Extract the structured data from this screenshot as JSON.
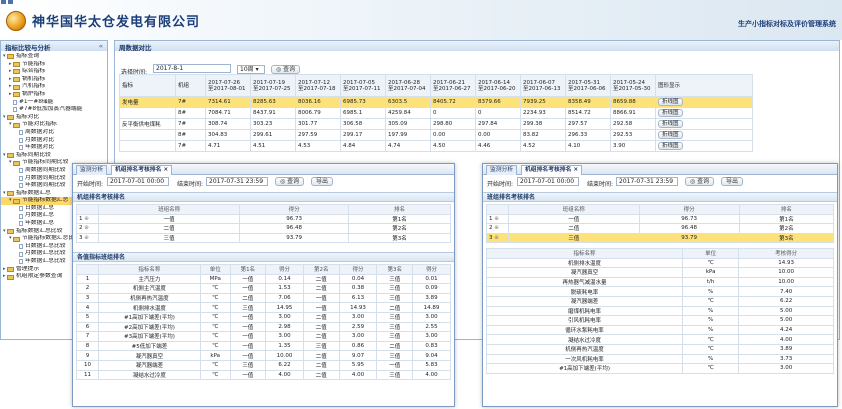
{
  "header": {
    "company": "神华国华太仓发电有限公司",
    "system": "生产小指标对标及评价管理系统"
  },
  "left": {
    "title": "指标比较与分析",
    "collapse": "«",
    "tree": [
      {
        "t": "指标查询",
        "lv": 0,
        "ty": "f",
        "tw": "▾"
      },
      {
        "t": "节能指标",
        "lv": 1,
        "ty": "f",
        "tw": "▸"
      },
      {
        "t": "综合指标",
        "lv": 1,
        "ty": "f",
        "tw": "▸"
      },
      {
        "t": "锅机指标",
        "lv": 1,
        "ty": "f",
        "tw": "▸"
      },
      {
        "t": "汽机指标",
        "lv": 1,
        "ty": "f",
        "tw": "▸"
      },
      {
        "t": "锅炉指标",
        "lv": 1,
        "ty": "f",
        "tw": "▸"
      },
      {
        "t": "#1一#8储能",
        "lv": 1,
        "ty": "d",
        "tw": ""
      },
      {
        "t": "#7#8低加加蒸汽器端能",
        "lv": 1,
        "ty": "d",
        "tw": ""
      },
      {
        "t": "指标对比",
        "lv": 0,
        "ty": "f",
        "tw": "▾"
      },
      {
        "t": "节能对比指标",
        "lv": 1,
        "ty": "f",
        "tw": "▾"
      },
      {
        "t": "周数据对比",
        "lv": 2,
        "ty": "d",
        "tw": ""
      },
      {
        "t": "月数据对比",
        "lv": 2,
        "ty": "d",
        "tw": ""
      },
      {
        "t": "年数据对比",
        "lv": 2,
        "ty": "d",
        "tw": ""
      },
      {
        "t": "指标同期比较",
        "lv": 0,
        "ty": "f",
        "tw": "▾"
      },
      {
        "t": "节能指标同期比较",
        "lv": 1,
        "ty": "f",
        "tw": "▾"
      },
      {
        "t": "周数据同期比较",
        "lv": 2,
        "ty": "d",
        "tw": ""
      },
      {
        "t": "月数据同期比较",
        "lv": 2,
        "ty": "d",
        "tw": ""
      },
      {
        "t": "年数据同期比较",
        "lv": 2,
        "ty": "d",
        "tw": ""
      },
      {
        "t": "指标数据汇总",
        "lv": 0,
        "ty": "f",
        "tw": "▾"
      },
      {
        "t": "节能指标数据汇总",
        "lv": 1,
        "ty": "f",
        "tw": "▾",
        "sel": true
      },
      {
        "t": "日数据汇总",
        "lv": 2,
        "ty": "d",
        "tw": ""
      },
      {
        "t": "月数据汇总",
        "lv": 2,
        "ty": "d",
        "tw": ""
      },
      {
        "t": "年数据汇总",
        "lv": 2,
        "ty": "d",
        "tw": ""
      },
      {
        "t": "指标数据汇总比较",
        "lv": 0,
        "ty": "f",
        "tw": "▾"
      },
      {
        "t": "节能指标数据汇总比较",
        "lv": 1,
        "ty": "f",
        "tw": "▾"
      },
      {
        "t": "日数据汇总比较",
        "lv": 2,
        "ty": "d",
        "tw": ""
      },
      {
        "t": "月数据汇总比较",
        "lv": 2,
        "ty": "d",
        "tw": ""
      },
      {
        "t": "年数据汇总比较",
        "lv": 2,
        "ty": "d",
        "tw": ""
      },
      {
        "t": "管理提示",
        "lv": 0,
        "ty": "f",
        "tw": "▸"
      },
      {
        "t": "机组限定参数查询",
        "lv": 0,
        "ty": "f",
        "tw": "▸"
      }
    ]
  },
  "weekly": {
    "title": "周数据对比",
    "time_label": "选择时间:",
    "time_value": "2017-8-1",
    "weeks_value": "10周",
    "query": "查询",
    "periods": [
      "2017-07-26\n至2017-08-01",
      "2017-07-19\n至2017-07-25",
      "2017-07-12\n至2017-07-18",
      "2017-07-05\n至2017-07-11",
      "2017-06-28\n至2017-07-04",
      "2017-06-21\n至2017-06-27",
      "2017-06-14\n至2017-06-20",
      "2017-06-07\n至2017-06-13",
      "2017-05-31\n至2017-06-06",
      "2017-05-24\n至2017-05-30"
    ],
    "col_ind": "指标",
    "col_unit": "机组",
    "col_chart": "图形显示",
    "chart_btn": "折线图",
    "rows": [
      {
        "ind": "发电量",
        "u": "7#",
        "v": [
          "7314.61",
          "8285.63",
          "8036.16",
          "6985.73",
          "6303.5",
          "8405.72",
          "8379.66",
          "7939.25",
          "8358.49",
          "8659.88"
        ],
        "hl": true
      },
      {
        "ind": "",
        "u": "8#",
        "v": [
          "7084.71",
          "8437.91",
          "8006.79",
          "6985.1",
          "4259.84",
          "0",
          "0",
          "2234.93",
          "8514.72",
          "8866.91"
        ]
      },
      {
        "ind": "反平衡供电煤耗",
        "u": "7#",
        "v": [
          "308.74",
          "303.23",
          "301.77",
          "306.58",
          "305.09",
          "298.80",
          "297.84",
          "299.38",
          "297.57",
          "292.58"
        ]
      },
      {
        "ind": "",
        "u": "8#",
        "v": [
          "304.83",
          "299.61",
          "297.59",
          "299.17",
          "197.99",
          "0.00",
          "0.00",
          "83.82",
          "296.33",
          "292.53"
        ]
      },
      {
        "ind": "",
        "u": "7#",
        "v": [
          "4.71",
          "4.51",
          "4.53",
          "4.84",
          "4.74",
          "4.50",
          "4.46",
          "4.52",
          "4.10",
          "3.90"
        ]
      }
    ]
  },
  "winA": {
    "tabs": [
      "监测分析",
      "机组排名考核排名"
    ],
    "tab_close": "×",
    "start_label": "开始时间:",
    "start_value": "2017-07-01 00:00",
    "end_label": "结束时间:",
    "end_value": "2017-07-31 23:59",
    "query": "查询",
    "export": "导出",
    "sec1": "机组排名考核排名",
    "hdr1": [
      "",
      "班组名称",
      "得分",
      "排名"
    ],
    "rank": [
      {
        "n": "1",
        "name": "一值",
        "score": "96.73",
        "rank": "第1名"
      },
      {
        "n": "2",
        "name": "二值",
        "score": "96.48",
        "rank": "第2名"
      },
      {
        "n": "3",
        "name": "三值",
        "score": "93.79",
        "rank": "第3名"
      }
    ],
    "sec2": "各值指标班组排名",
    "hdr2": [
      "",
      "指标名称",
      "单位",
      "第1名",
      "得分",
      "第2名",
      "得分",
      "第3名",
      "得分"
    ],
    "rows2": [
      [
        "1",
        "主汽压力",
        "MPa",
        "一值",
        "0.14",
        "二值",
        "0.04",
        "三值",
        "0.01"
      ],
      [
        "2",
        "机侧主汽温度",
        "℃",
        "一值",
        "1.53",
        "二值",
        "0.38",
        "三值",
        "0.09"
      ],
      [
        "3",
        "机侧再热汽温度",
        "℃",
        "二值",
        "7.06",
        "一值",
        "6.13",
        "三值",
        "3.89"
      ],
      [
        "4",
        "机侧排水温度",
        "℃",
        "三值",
        "14.95",
        "一值",
        "14.93",
        "二值",
        "14.89"
      ],
      [
        "5",
        "#1高加下端差(平均)",
        "℃",
        "一值",
        "3.00",
        "二值",
        "3.00",
        "三值",
        "3.00"
      ],
      [
        "6",
        "#2高加下端差(平均)",
        "℃",
        "一值",
        "2.98",
        "二值",
        "2.59",
        "三值",
        "2.55"
      ],
      [
        "7",
        "#3高加下端差(平均)",
        "℃",
        "一值",
        "3.00",
        "二值",
        "3.00",
        "三值",
        "3.00"
      ],
      [
        "8",
        "#5低加下端差",
        "℃",
        "一值",
        "1.35",
        "三值",
        "0.86",
        "二值",
        "0.83"
      ],
      [
        "9",
        "凝汽器真空",
        "kPa",
        "一值",
        "10.00",
        "二值",
        "9.07",
        "三值",
        "9.04"
      ],
      [
        "10",
        "凝汽器端差",
        "℃",
        "三值",
        "6.22",
        "二值",
        "5.95",
        "一值",
        "5.83"
      ],
      [
        "11",
        "凝结水过冷度",
        "℃",
        "一值",
        "4.00",
        "二值",
        "4.00",
        "三值",
        "4.00"
      ]
    ]
  },
  "winB": {
    "tabs": [
      "监测分析",
      "机组排名考核排名"
    ],
    "tab_close": "×",
    "start_label": "开始时间:",
    "start_value": "2017-07-01 00:00",
    "end_label": "结束时间:",
    "end_value": "2017-07-31 23:59",
    "query": "查询",
    "export": "导出",
    "sec1": "班组排名考核排名",
    "hdr1": [
      "",
      "班组名称",
      "得分",
      "排名"
    ],
    "rank": [
      {
        "n": "1",
        "name": "一值",
        "score": "96.73",
        "rank": "第1名"
      },
      {
        "n": "2",
        "name": "二值",
        "score": "96.48",
        "rank": "第2名"
      },
      {
        "n": "3",
        "name": "三值",
        "score": "93.79",
        "rank": "第3名",
        "hl": true
      }
    ],
    "hdr2": [
      "指标名称",
      "单位",
      "考核得分"
    ],
    "rows2": [
      [
        "机侧排水温度",
        "℃",
        "14.93"
      ],
      [
        "凝汽器真空",
        "kPa",
        "10.00"
      ],
      [
        "再热器气减温水量",
        "t/h",
        "10.00"
      ],
      [
        "脱硫耗电率",
        "%",
        "7.40"
      ],
      [
        "凝汽器端差",
        "℃",
        "6.22"
      ],
      [
        "磨煤机耗电率",
        "%",
        "5.00"
      ],
      [
        "引风机耗电率",
        "%",
        "5.00"
      ],
      [
        "循环水泵耗电率",
        "%",
        "4.24"
      ],
      [
        "凝结水过冷度",
        "℃",
        "4.00"
      ],
      [
        "机侧再热汽温度",
        "℃",
        "3.89"
      ],
      [
        "一次风机耗电率",
        "%",
        "3.73"
      ],
      [
        "#1高加下端差(平均)",
        "℃",
        "3.00"
      ]
    ]
  }
}
